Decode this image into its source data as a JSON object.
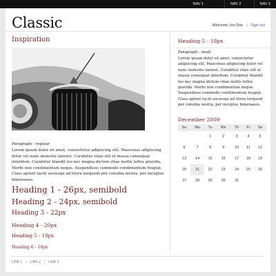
{
  "topnav": [
    "NAV 1",
    "NAV 2",
    "NAV 3"
  ],
  "header": {
    "logo": "Classic",
    "welcome": "Welcome Jon Doe",
    "separator": "|",
    "signout": "Sign out"
  },
  "main": {
    "section_title": "Inspiration",
    "paragraph_label": "Paragraph - regular",
    "paragraph_text": "Lorem ipsum dolor sit amet, consectetur adipiscing elit. Maecenas adipiscing dolor vel nunc molestie laoreet. Curabitur vitae elit et massa consequat interdum. Curabitur blandit leo nec magna dictum vitae mollis tellus gravida. Morbi non condimentum neque. Suspendisse commodo condimentum feugiat. Class aptent taciti sociosqu ad litora torquent per conubia nostra, per inceptos himenaeos.",
    "headings": {
      "h1": "Heading 1 - 26px, semibold",
      "h2": "Heading 2 - 24px, semibold",
      "h3": "Heading 3 - 22px",
      "h4": "Heading 4 - 20px",
      "h5": "Heading 5 - 18px",
      "h6": "Heading 6 - 16px"
    }
  },
  "sidebar": {
    "heading": "Heading 5 - 18px",
    "small_label": "Paragraph - small",
    "small_text": "Lorem ipsum dolor sit amet, consectetur adipiscing elit. Maecenas adipiscing dolor vel nunc molestie laoreet. Curabitur vitae elit et massa consequat interdum. Curabitur blandit leo nec magna dictum vitae mollis tellus gravida. Morbi non condimentum neque. Suspendisse commodo condimentum feugiat. Class aptent taciti sociosqu ad litora torquent per conubia nostra, per inceptos himenaeos."
  },
  "calendar": {
    "title": "December 2009",
    "days": [
      "Su",
      "Mo",
      "Tu",
      "We",
      "Th",
      "Fr",
      "Sa"
    ],
    "weeks": [
      [
        "",
        "",
        "1",
        "2",
        "3",
        "4",
        "5"
      ],
      [
        "6",
        "7",
        "8",
        "9",
        "10",
        "11",
        "12"
      ],
      [
        "13",
        "14",
        "15",
        "16",
        "17",
        "18",
        "19"
      ],
      [
        "20",
        "21",
        "22",
        "23",
        "24",
        "25",
        "26"
      ],
      [
        "27",
        "28",
        "29",
        "30",
        "31",
        "",
        ""
      ]
    ],
    "today": "21"
  },
  "footer": {
    "links": [
      "LINK 1",
      "LINK 2",
      "LINK 3"
    ],
    "separator": "|"
  },
  "colors": {
    "accent": "#8b1a1a",
    "topbar": "#111111",
    "link": "#3366aa"
  }
}
